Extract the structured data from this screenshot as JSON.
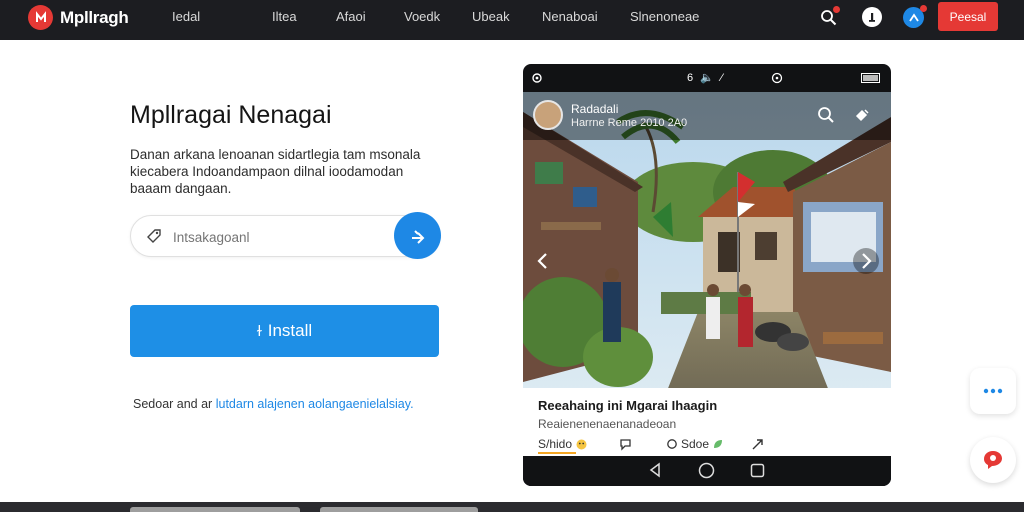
{
  "brand": {
    "name": "Mpllragh",
    "logo_icon": "brand-logo-icon"
  },
  "nav": {
    "items": [
      {
        "label": "Iedal"
      },
      {
        "label": "Iltea"
      },
      {
        "label": "Afaoi"
      },
      {
        "label": "Voedk"
      },
      {
        "label": "Ubeak"
      },
      {
        "label": "Nenaboai"
      },
      {
        "label": "Slnenoneae"
      }
    ],
    "cta_label": "Peesal"
  },
  "hero": {
    "title": "Mpllragai Nenagai",
    "description": "Danan arkana lenoanan sidartlegia tam msonala kiecabera Indoandampaon dilnal ioodamodan baaam dangaan.",
    "search": {
      "placeholder": "Intsakagoanl"
    },
    "install_label": "Install",
    "install_glyph": "ɫ",
    "footnote_text": "Sedoar and ar",
    "footnote_link": "lutdarn alajenen aolangaenielalsiay."
  },
  "phone": {
    "status_left": "6 🔈 ⁄",
    "post": {
      "author": "Radadali",
      "meta": "Harrne Reme 2010 2A0",
      "title": "Reeahaing ini Mgarai Ihaagin",
      "subtitle": "Reaienenenaenanadeoan",
      "actions": [
        {
          "label": "S/hido",
          "icon": "like-icon"
        },
        {
          "label": "",
          "icon": "comment-icon"
        },
        {
          "label": "Sdoe",
          "icon": "save-icon"
        },
        {
          "label": "",
          "icon": "share-icon"
        }
      ]
    }
  },
  "colors": {
    "topbar": "#1c1d21",
    "accent_blue": "#1e88e5",
    "accent_red": "#e53935"
  }
}
